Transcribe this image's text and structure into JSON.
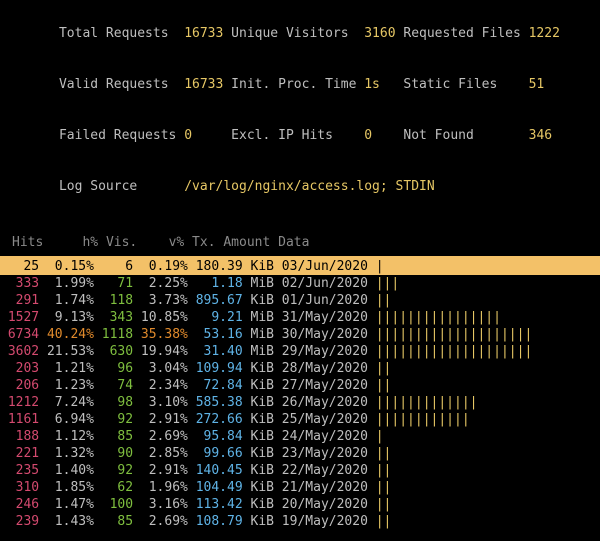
{
  "header": {
    "total_requests_label": "Total Requests",
    "total_requests": "16733",
    "unique_visitors_label": "Unique Visitors",
    "unique_visitors": "3160",
    "requested_files_label": "Requested Files",
    "requested_files": "1222",
    "valid_requests_label": "Valid Requests",
    "valid_requests": "16733",
    "init_proc_time_label": "Init. Proc. Time",
    "init_proc_time": "1s",
    "static_files_label": "Static Files",
    "static_files": "51",
    "failed_requests_label": "Failed Requests",
    "failed_requests": "0",
    "excl_ip_hits_label": "Excl. IP Hits",
    "excl_ip_hits": "0",
    "not_found_label": "Not Found",
    "not_found": "346",
    "log_source_label": "Log Source",
    "log_source": "/var/log/nginx/access.log; STDIN"
  },
  "columns": {
    "hits": "Hits",
    "hpct": "h%",
    "vis": "Vis.",
    "vpct": "v%",
    "tx": "Tx.",
    "amount": "Amount",
    "data": "Data"
  },
  "rows": [
    {
      "hits": "25",
      "hpct": "0.15%",
      "vis": "6",
      "vpct": "0.19%",
      "amt": "180.39",
      "unit": "KiB",
      "date": "03/Jun/2020",
      "bar": "|",
      "sel": true
    },
    {
      "hits": "333",
      "hpct": "1.99%",
      "vis": "71",
      "vpct": "2.25%",
      "amt": "1.18",
      "unit": "MiB",
      "date": "02/Jun/2020",
      "bar": "|||"
    },
    {
      "hits": "291",
      "hpct": "1.74%",
      "vis": "118",
      "vpct": "3.73%",
      "amt": "895.67",
      "unit": "KiB",
      "date": "01/Jun/2020",
      "bar": "||"
    },
    {
      "hits": "1527",
      "hpct": "9.13%",
      "vis": "343",
      "vpct": "10.85%",
      "amt": "9.21",
      "unit": "MiB",
      "date": "31/May/2020",
      "bar": "||||||||||||||||"
    },
    {
      "hits": "6734",
      "hpct": "40.24%",
      "vis": "1118",
      "vpct": "35.38%",
      "amt": "53.16",
      "unit": "MiB",
      "date": "30/May/2020",
      "bar": "||||||||||||||||||||",
      "orange": true
    },
    {
      "hits": "3602",
      "hpct": "21.53%",
      "vis": "630",
      "vpct": "19.94%",
      "amt": "31.40",
      "unit": "MiB",
      "date": "29/May/2020",
      "bar": "||||||||||||||||||||"
    },
    {
      "hits": "203",
      "hpct": "1.21%",
      "vis": "96",
      "vpct": "3.04%",
      "amt": "109.94",
      "unit": "KiB",
      "date": "28/May/2020",
      "bar": "||"
    },
    {
      "hits": "206",
      "hpct": "1.23%",
      "vis": "74",
      "vpct": "2.34%",
      "amt": "72.84",
      "unit": "KiB",
      "date": "27/May/2020",
      "bar": "||"
    },
    {
      "hits": "1212",
      "hpct": "7.24%",
      "vis": "98",
      "vpct": "3.10%",
      "amt": "585.38",
      "unit": "KiB",
      "date": "26/May/2020",
      "bar": "|||||||||||||"
    },
    {
      "hits": "1161",
      "hpct": "6.94%",
      "vis": "92",
      "vpct": "2.91%",
      "amt": "272.66",
      "unit": "KiB",
      "date": "25/May/2020",
      "bar": "||||||||||||"
    },
    {
      "hits": "188",
      "hpct": "1.12%",
      "vis": "85",
      "vpct": "2.69%",
      "amt": "95.84",
      "unit": "KiB",
      "date": "24/May/2020",
      "bar": "|"
    },
    {
      "hits": "221",
      "hpct": "1.32%",
      "vis": "90",
      "vpct": "2.85%",
      "amt": "99.66",
      "unit": "KiB",
      "date": "23/May/2020",
      "bar": "||"
    },
    {
      "hits": "235",
      "hpct": "1.40%",
      "vis": "92",
      "vpct": "2.91%",
      "amt": "140.45",
      "unit": "KiB",
      "date": "22/May/2020",
      "bar": "||"
    },
    {
      "hits": "310",
      "hpct": "1.85%",
      "vis": "62",
      "vpct": "1.96%",
      "amt": "104.49",
      "unit": "KiB",
      "date": "21/May/2020",
      "bar": "||"
    },
    {
      "hits": "246",
      "hpct": "1.47%",
      "vis": "100",
      "vpct": "3.16%",
      "amt": "113.42",
      "unit": "KiB",
      "date": "20/May/2020",
      "bar": "||"
    },
    {
      "hits": "239",
      "hpct": "1.43%",
      "vis": "85",
      "vpct": "2.69%",
      "amt": "108.79",
      "unit": "KiB",
      "date": "19/May/2020",
      "bar": "||"
    }
  ]
}
